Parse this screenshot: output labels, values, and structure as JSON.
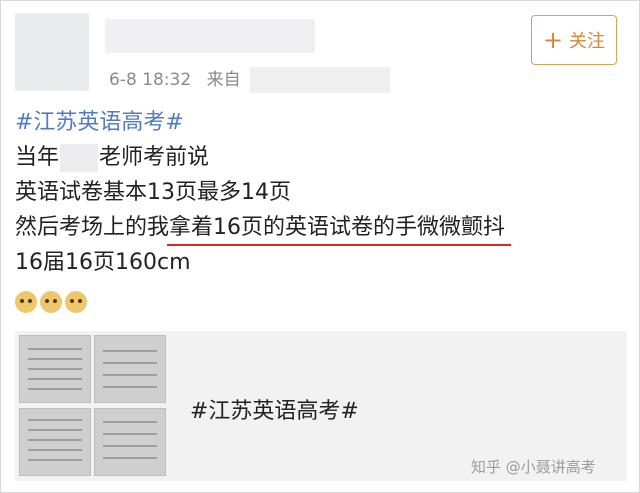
{
  "post": {
    "time": "6-8 18:32",
    "source_prefix": "来自",
    "follow_label": "关注",
    "follow_icon": "plus-icon",
    "lines": {
      "hashtag": "#江苏英语高考#",
      "line2_a": "当年",
      "line2_b": "老师考前说",
      "line3": "英语试卷基本13页最多14页",
      "line4_a": "然后考场上的我",
      "line4_b": "拿着16页的英语试卷的手微微颤抖",
      "line5": "16届16页160cm"
    },
    "emojis": [
      "doge-emoji",
      "doge-emoji",
      "doge-emoji"
    ]
  },
  "share": {
    "tag": "#江苏英语高考#"
  },
  "watermark": "知乎 @小聂讲高考",
  "colors": {
    "hashtag": "#4f7cc2",
    "follow": "#d9872f",
    "underline": "#d12a2a"
  }
}
